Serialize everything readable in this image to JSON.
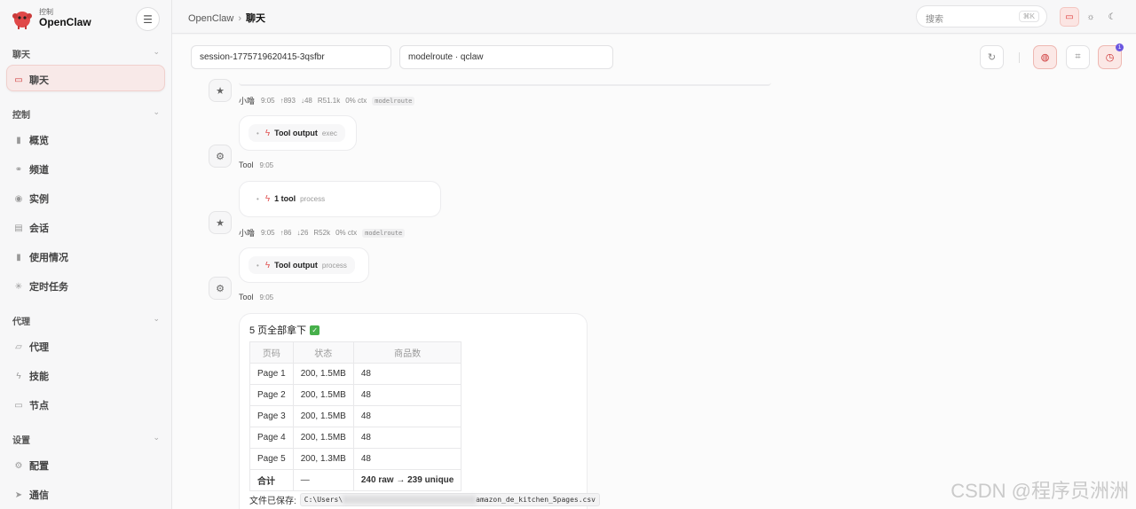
{
  "brand": {
    "subtitle": "控制",
    "name": "OpenClaw"
  },
  "sidebar": {
    "sections": [
      {
        "title": "聊天",
        "items": [
          {
            "label": "聊天",
            "icon": "chat-icon"
          }
        ]
      },
      {
        "title": "控制",
        "items": [
          {
            "label": "概览",
            "icon": "bar-chart-icon"
          },
          {
            "label": "频道",
            "icon": "link-icon"
          },
          {
            "label": "实例",
            "icon": "broadcast-icon"
          },
          {
            "label": "会话",
            "icon": "document-icon"
          },
          {
            "label": "使用情况",
            "icon": "bar-chart-icon"
          },
          {
            "label": "定时任务",
            "icon": "loader-icon"
          }
        ]
      },
      {
        "title": "代理",
        "items": [
          {
            "label": "代理",
            "icon": "folder-icon"
          },
          {
            "label": "技能",
            "icon": "bolt-icon"
          },
          {
            "label": "节点",
            "icon": "monitor-icon"
          }
        ]
      },
      {
        "title": "设置",
        "items": [
          {
            "label": "配置",
            "icon": "gear-icon"
          },
          {
            "label": "通信",
            "icon": "send-icon"
          }
        ]
      }
    ]
  },
  "topbar": {
    "breadcrumb_root": "OpenClaw",
    "breadcrumb_current": "聊天",
    "search_placeholder": "搜索",
    "search_shortcut": "⌘K"
  },
  "chat": {
    "session": "session-1775719620415-3qsfbr",
    "model": "modelroute · qclaw",
    "badge_count": "1",
    "messages": [
      {
        "who": "小噜",
        "time": "9:05",
        "up": "↑893",
        "down": "↓48",
        "r": "R51.1k",
        "ctx": "0% ctx",
        "tag": "modelroute"
      },
      {
        "tool_name": "Tool output",
        "tool_arg": "exec",
        "who": "Tool",
        "time": "9:05"
      },
      {
        "tool_name": "1 tool",
        "tool_arg": "process"
      },
      {
        "who": "小噜",
        "time": "9:05",
        "up": "↑86",
        "down": "↓26",
        "r": "R52k",
        "ctx": "0% ctx",
        "tag": "modelroute"
      },
      {
        "tool_name": "Tool output",
        "tool_arg": "process",
        "who": "Tool",
        "time": "9:05"
      }
    ],
    "result": {
      "title": "5 页全部拿下",
      "headers": [
        "页码",
        "状态",
        "商品数"
      ],
      "rows": [
        [
          "Page 1",
          "200, 1.5MB",
          "48"
        ],
        [
          "Page 2",
          "200, 1.5MB",
          "48"
        ],
        [
          "Page 3",
          "200, 1.5MB",
          "48"
        ],
        [
          "Page 4",
          "200, 1.5MB",
          "48"
        ],
        [
          "Page 5",
          "200, 1.3MB",
          "48"
        ]
      ],
      "total": [
        "合计",
        "—",
        "240 raw → 239 unique"
      ],
      "saved_label": "文件已保存:",
      "path_prefix": "C:\\Users\\",
      "path_suffix": "amazon_de_kitchen_5pages.csv"
    }
  },
  "watermark": "CSDN @程序员洲洲"
}
